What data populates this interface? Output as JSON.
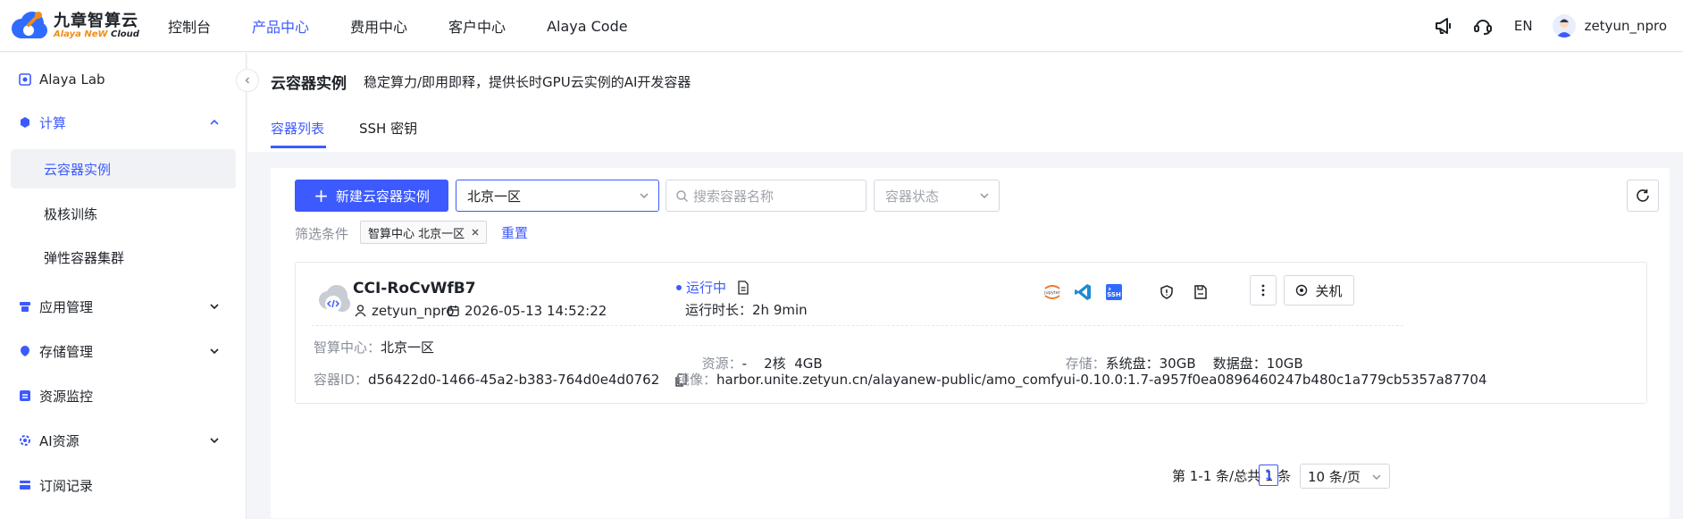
{
  "brand": {
    "name_cn": "九章智算云",
    "name_en_a": "Alaya NeW",
    "name_en_b": "Cloud"
  },
  "topnav": {
    "items": [
      "控制台",
      "产品中心",
      "费用中心",
      "客户中心",
      "Alaya Code"
    ],
    "active_index": 1
  },
  "topright": {
    "lang": "EN",
    "username": "zetyun_npro"
  },
  "sidebar": {
    "items": [
      {
        "label": "Alaya Lab",
        "icon": "lab-icon"
      },
      {
        "label": "计算",
        "icon": "cube-icon",
        "expanded": true
      },
      {
        "label": "云容器实例",
        "sub": true,
        "active": true
      },
      {
        "label": "极核训练",
        "sub": true
      },
      {
        "label": "弹性容器集群",
        "sub": true
      },
      {
        "label": "应用管理",
        "icon": "app-icon",
        "collapsible": true
      },
      {
        "label": "存储管理",
        "icon": "storage-icon",
        "collapsible": true
      },
      {
        "label": "资源监控",
        "icon": "monitor-icon"
      },
      {
        "label": "AI资源",
        "icon": "ai-icon",
        "collapsible": true
      },
      {
        "label": "订阅记录",
        "icon": "subscription-icon"
      }
    ]
  },
  "page": {
    "title": "云容器实例",
    "description": "稳定算力/即用即释，提供长时GPU云实例的AI开发容器",
    "tabs": [
      "容器列表",
      "SSH 密钥"
    ],
    "active_tab": 0
  },
  "toolbar": {
    "create_label": "新建云容器实例",
    "region_value": "北京一区",
    "search_placeholder": "搜索容器名称",
    "status_placeholder": "容器状态"
  },
  "filter": {
    "label": "筛选条件",
    "tag": "智算中心 北京一区",
    "reset": "重置"
  },
  "instance": {
    "name": "CCI-RoCvWfB7",
    "owner": "zetyun_npro",
    "created": "2026-05-13 14:52:22",
    "status": "运行中",
    "runtime": "运行时长：2h 9min",
    "stop_label": "关机",
    "center_k": "智算中心：",
    "center_v": "北京一区",
    "resource_k": "资源：",
    "resource_v": "-    2核  4GB",
    "storage_k": "存储：",
    "storage_v": "系统盘：30GB    数据盘：10GB",
    "id_k": "容器ID：",
    "id_v": "d56422d0-1466-45a2-b383-764d0e4d0762",
    "image_k": "镜像：",
    "image_v": "harbor.unite.zetyun.cn/alayanew-public/amo_comfyui-0.10.0:1.7-a957f0ea0896460247b480c1a779cb5357a87704",
    "tool_icons": [
      "jupyter-icon",
      "vscode-icon",
      "ssh-icon",
      "shield-icon",
      "save-icon"
    ]
  },
  "pagination": {
    "total_text": "第 1-1 条/总共 1 条",
    "current_page": "1",
    "page_size": "10 条/页"
  },
  "colors": {
    "accent": "#3d5afe",
    "brand_orange": "#f08c1a"
  }
}
